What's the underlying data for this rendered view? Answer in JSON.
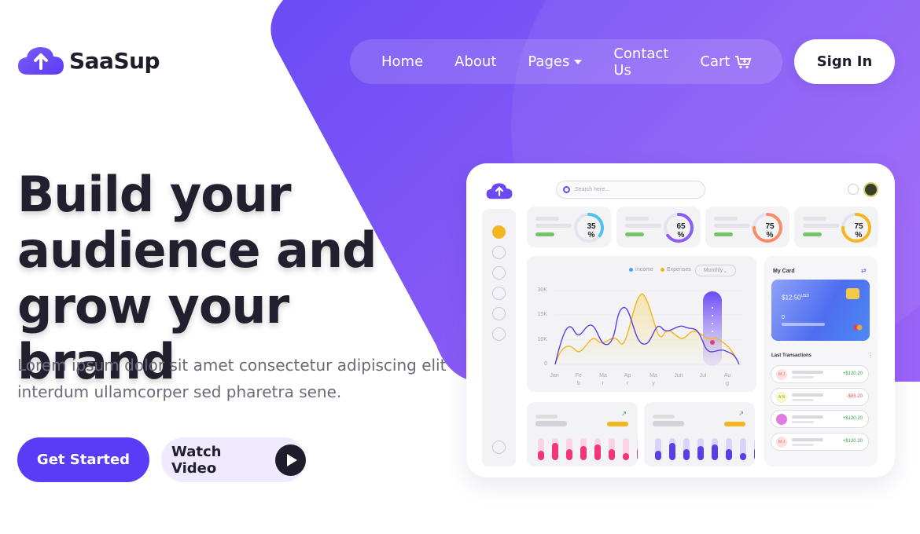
{
  "brand": {
    "name": "SaaSup",
    "accent": "#5b3cf6",
    "gradient_start": "#6a4cf5",
    "gradient_end": "#9b5ff7"
  },
  "nav": {
    "items": [
      {
        "label": "Home"
      },
      {
        "label": "About"
      },
      {
        "label": "Pages",
        "has_dropdown": true
      },
      {
        "label": "Contact Us"
      },
      {
        "label": "Cart",
        "icon": "cart-icon"
      }
    ],
    "signin_label": "Sign In"
  },
  "hero": {
    "title_lines": [
      "Build your",
      "audience and",
      "grow your brand"
    ],
    "subtitle_lines": [
      "Lorem ipsum dolor sit amet consectetur adipiscing elit",
      "interdum ullamcorper sed pharetra sene."
    ],
    "primary_cta": "Get Started",
    "secondary_cta": "Watch Video"
  },
  "dashboard": {
    "search_placeholder": "Search here...",
    "stat_cards": [
      {
        "value": "35",
        "unit": "%",
        "color": "#4fc3f0",
        "fraction": 0.35
      },
      {
        "value": "65",
        "unit": "%",
        "color": "#8b5cf6",
        "fraction": 0.65
      },
      {
        "value": "75",
        "unit": "%",
        "color": "#f98b66",
        "fraction": 0.75
      },
      {
        "value": "75",
        "unit": "%",
        "color": "#f5b51e",
        "fraction": 0.75
      }
    ],
    "chart": {
      "legend": [
        {
          "label": "Income",
          "color": "#4fa3f0"
        },
        {
          "label": "Expenses",
          "color": "#f5b51e"
        }
      ],
      "period": "Monthly",
      "y_ticks": [
        "30K",
        "15K",
        "10K",
        "0"
      ],
      "x_ticks": [
        [
          "Jan",
          ""
        ],
        [
          "Fe",
          "b"
        ],
        [
          "Ma",
          "r"
        ],
        [
          "Ap",
          "r"
        ],
        [
          "Ma",
          "y"
        ],
        [
          "Jun",
          ""
        ],
        [
          "Jul",
          ""
        ],
        [
          "Au",
          "g"
        ]
      ]
    },
    "my_card": {
      "title": "My Card",
      "amount": "$12.50",
      "currency": "USD",
      "balance": "0"
    },
    "last_transactions": {
      "title": "Last Transactions",
      "items": [
        {
          "initials": "M J",
          "amount": "+$120.20",
          "color": "#3b9a46",
          "avatar_bg": "#fde0e0",
          "avatar_fg": "#e06b6b"
        },
        {
          "initials": "A N",
          "amount": "-$85.20",
          "color": "#e25555",
          "avatar_bg": "#f5f7c8",
          "avatar_fg": "#a0a020"
        },
        {
          "initials": "",
          "amount": "+$120.20",
          "color": "#3b9a46",
          "avatar_bg": "#e07ce0",
          "avatar_fg": "#ffffff"
        },
        {
          "initials": "M J",
          "amount": "+$120.20",
          "color": "#3b9a46",
          "avatar_bg": "#fde0e0",
          "avatar_fg": "#e06b6b"
        }
      ]
    }
  }
}
